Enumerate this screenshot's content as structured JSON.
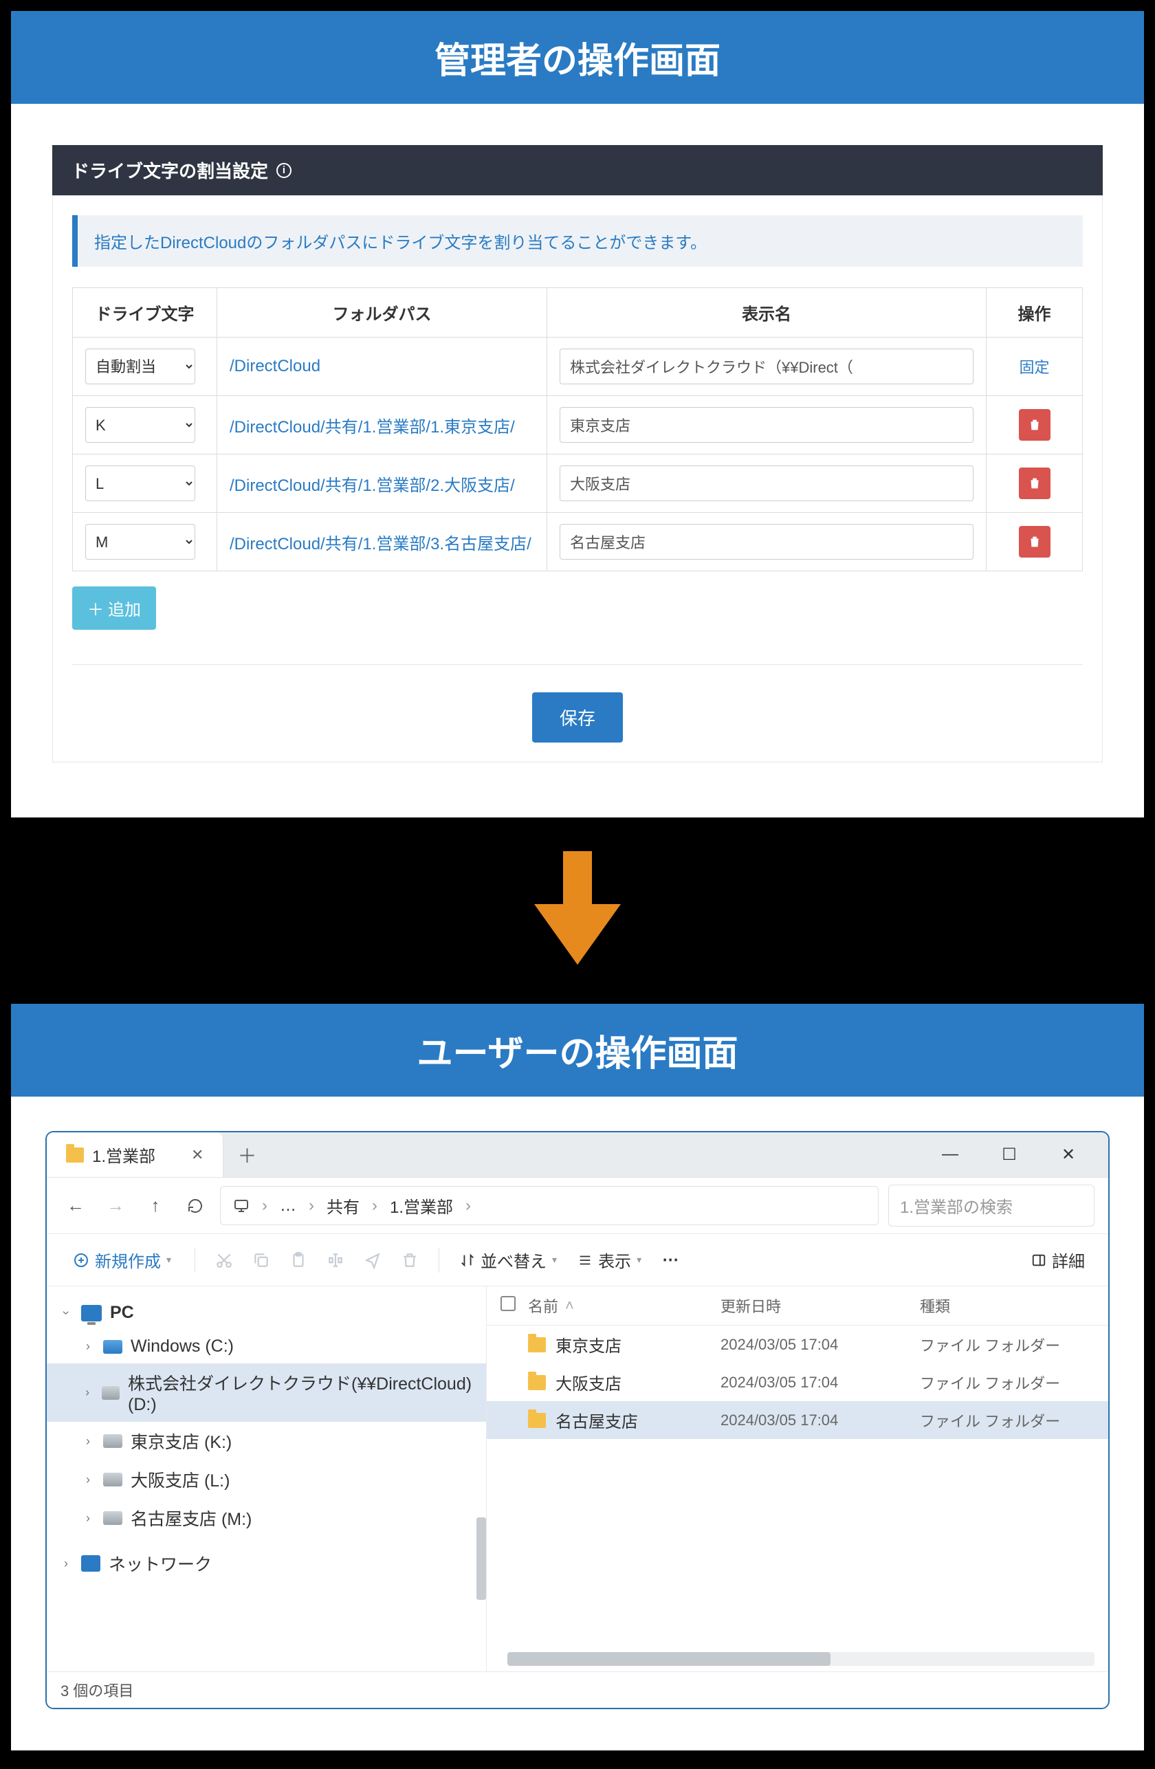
{
  "admin": {
    "header": "管理者の操作画面",
    "panel_title": "ドライブ文字の割当設定",
    "notice": "指定したDirectCloudのフォルダパスにドライブ文字を割り当てることができます。",
    "columns": {
      "drive": "ドライブ文字",
      "path": "フォルダパス",
      "display": "表示名",
      "op": "操作"
    },
    "rows": [
      {
        "drive": "自動割当",
        "path": "/DirectCloud",
        "display": "株式会社ダイレクトクラウド（¥¥Direct（",
        "op_fixed": "固定"
      },
      {
        "drive": "K",
        "path": "/DirectCloud/共有/1.営業部/1.東京支店/",
        "display": "東京支店",
        "op_fixed": null
      },
      {
        "drive": "L",
        "path": "/DirectCloud/共有/1.営業部/2.大阪支店/",
        "display": "大阪支店",
        "op_fixed": null
      },
      {
        "drive": "M",
        "path": "/DirectCloud/共有/1.営業部/3.名古屋支店/",
        "display": "名古屋支店",
        "op_fixed": null
      }
    ],
    "add_btn": "追加",
    "save_btn": "保存"
  },
  "user": {
    "header": "ユーザーの操作画面",
    "tab_title": "1.営業部",
    "breadcrumb": {
      "ellipsis": "…",
      "share": "共有",
      "current": "1.営業部"
    },
    "search_placeholder": "1.営業部の検索",
    "toolbar": {
      "new": "新規作成",
      "sort": "並べ替え",
      "view": "表示",
      "detail": "詳細"
    },
    "tree": {
      "pc": "PC",
      "windows": "Windows (C:)",
      "direct": "株式会社ダイレクトクラウド(¥¥DirectCloud) (D:)",
      "tokyo": "東京支店 (K:)",
      "osaka": "大阪支店 (L:)",
      "nagoya": "名古屋支店 (M:)",
      "network": "ネットワーク"
    },
    "list_headers": {
      "name": "名前",
      "date": "更新日時",
      "type": "種類"
    },
    "files": [
      {
        "name": "東京支店",
        "date": "2024/03/05 17:04",
        "type": "ファイル フォルダー",
        "selected": false
      },
      {
        "name": "大阪支店",
        "date": "2024/03/05 17:04",
        "type": "ファイル フォルダー",
        "selected": false
      },
      {
        "name": "名古屋支店",
        "date": "2024/03/05 17:04",
        "type": "ファイル フォルダー",
        "selected": true
      }
    ],
    "status": "3 個の項目"
  }
}
